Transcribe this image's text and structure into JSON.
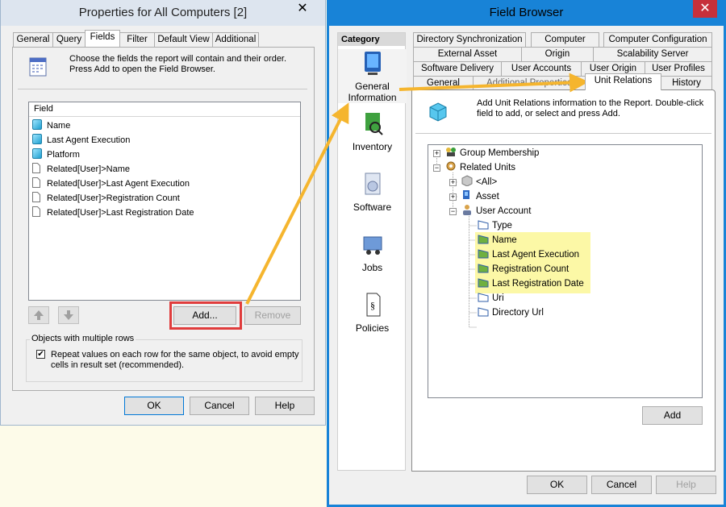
{
  "left_window": {
    "title": "Properties for All Computers [2]",
    "close": "✕",
    "tabs": [
      "General",
      "Query",
      "Fields",
      "Filter",
      "Default View",
      "Additional"
    ],
    "description": [
      "Choose the fields the report will contain and their order.",
      "Press Add to open the Field Browser."
    ],
    "list_header": "Field",
    "fields": [
      {
        "label": "Name",
        "icon": "cube-icon"
      },
      {
        "label": "Last Agent Execution",
        "icon": "cube-icon"
      },
      {
        "label": "Platform",
        "icon": "cube-icon"
      },
      {
        "label": "Related[User]>Name",
        "icon": "document-icon"
      },
      {
        "label": "Related[User]>Last Agent Execution",
        "icon": "document-icon"
      },
      {
        "label": "Related[User]>Registration Count",
        "icon": "document-icon"
      },
      {
        "label": "Related[User]>Last Registration Date",
        "icon": "document-icon"
      }
    ],
    "add_button": "Add...",
    "remove_button": "Remove",
    "group_label": "Objects with multiple rows",
    "checkbox_label": [
      "Repeat values on each row for the same object, to avoid empty",
      "cells in result set (recommended)."
    ],
    "ok": "OK",
    "cancel": "Cancel",
    "help": "Help"
  },
  "right_window": {
    "title": "Field Browser",
    "close": "✕",
    "category_header": "Category",
    "categories": [
      {
        "label": [
          "General",
          "Information"
        ],
        "icon": "computer-icon"
      },
      {
        "label": [
          "Inventory"
        ],
        "icon": "inventory-icon"
      },
      {
        "label": [
          "Software"
        ],
        "icon": "software-icon"
      },
      {
        "label": [
          "Jobs"
        ],
        "icon": "jobs-icon"
      },
      {
        "label": [
          "Policies"
        ],
        "icon": "policies-icon"
      }
    ],
    "tabs_row1": [
      "Directory Synchronization",
      "Computer",
      "Computer Configuration"
    ],
    "tabs_row2": [
      "External Asset",
      "Origin",
      "Scalability Server"
    ],
    "tabs_row3": [
      "Software Delivery",
      "User Accounts",
      "User Origin",
      "User Profiles"
    ],
    "tabs_row4": [
      "General",
      "Additional Properties",
      "Unit Relations",
      "History"
    ],
    "description": [
      "Add Unit Relations information to the Report. Double-click",
      "field to add, or select and press Add."
    ],
    "tree": {
      "group_membership": "Group Membership",
      "related_units": "Related Units",
      "all": "<All>",
      "asset": "Asset",
      "user_account": "User Account",
      "type": "Type",
      "name": "Name",
      "last_agent_execution": "Last Agent Execution",
      "registration_count": "Registration Count",
      "last_registration_date": "Last Registration Date",
      "uri": "Uri",
      "directory_url": "Directory Url"
    },
    "add_button": "Add",
    "ok": "OK",
    "cancel": "Cancel",
    "help": "Help"
  },
  "colors": {
    "highlight": "#fcf8a6",
    "arrow": "#f5b52e",
    "callout": "#e03c3c",
    "title_active": "#1883d7"
  }
}
